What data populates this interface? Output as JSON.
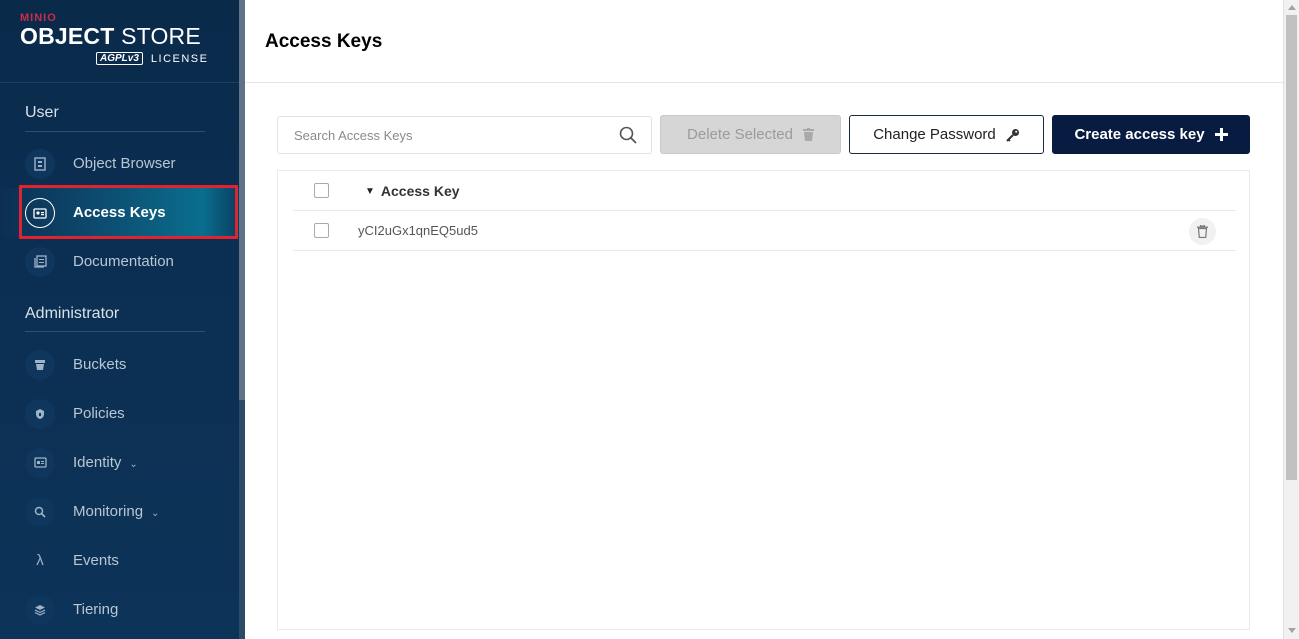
{
  "logo": {
    "brand_small": "MINIO",
    "brand_main_bold": "OBJECT",
    "brand_main_light": " STORE",
    "license_badge": "AGPLv3",
    "license_text": "LICENSE"
  },
  "sidebar": {
    "user_section": "User",
    "admin_section": "Administrator",
    "user_items": [
      {
        "label": "Object Browser",
        "icon": "object-browser-icon"
      },
      {
        "label": "Access Keys",
        "icon": "access-keys-icon",
        "active": true
      },
      {
        "label": "Documentation",
        "icon": "documentation-icon"
      }
    ],
    "admin_items": [
      {
        "label": "Buckets",
        "icon": "buckets-icon"
      },
      {
        "label": "Policies",
        "icon": "policies-icon"
      },
      {
        "label": "Identity",
        "icon": "identity-icon",
        "expandable": true
      },
      {
        "label": "Monitoring",
        "icon": "monitoring-icon",
        "expandable": true
      },
      {
        "label": "Events",
        "icon": "lambda-icon"
      },
      {
        "label": "Tiering",
        "icon": "tiering-icon"
      }
    ]
  },
  "header": {
    "title": "Access Keys"
  },
  "toolbar": {
    "search_placeholder": "Search Access Keys",
    "delete_selected": "Delete Selected",
    "change_password": "Change Password",
    "create_access_key": "Create access key"
  },
  "table": {
    "column_header": "Access Key",
    "rows": [
      {
        "access_key": "yCI2uGx1qnEQ5ud5"
      }
    ]
  },
  "colors": {
    "sidebar_bg": "#0b2f52",
    "primary_button": "#081c42",
    "highlight_border": "#e0242f"
  }
}
